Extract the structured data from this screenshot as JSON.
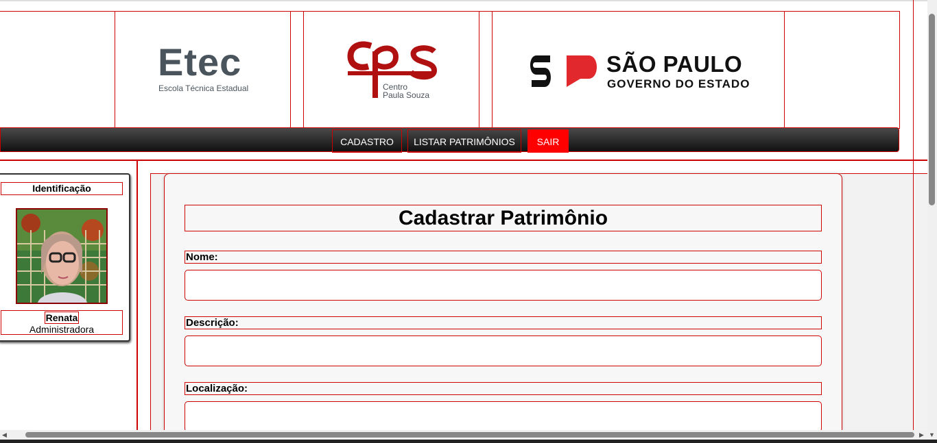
{
  "header": {
    "etec": {
      "word": "Etec",
      "subtitle": "Escola Técnica Estadual"
    },
    "cps": {
      "line1": "Centro",
      "line2": "Paula Souza"
    },
    "sp": {
      "title": "SÃO PAULO",
      "subtitle": "GOVERNO DO ESTADO"
    }
  },
  "nav": {
    "items": [
      {
        "label": "CADASTRO"
      },
      {
        "label": "LISTAR PATRIMÔNIOS"
      },
      {
        "label": "SAIR"
      }
    ],
    "active_color": "#ff0000"
  },
  "sidebar": {
    "heading": "Identificação",
    "user": {
      "name": "Renata",
      "role": "Administradora"
    }
  },
  "form": {
    "title": "Cadastrar Patrimônio",
    "fields": [
      {
        "label": "Nome:",
        "value": ""
      },
      {
        "label": "Descrição:",
        "value": ""
      },
      {
        "label": "Localização:",
        "value": ""
      }
    ]
  },
  "colors": {
    "accent": "#cc0000",
    "nav_bg": "#222222"
  }
}
